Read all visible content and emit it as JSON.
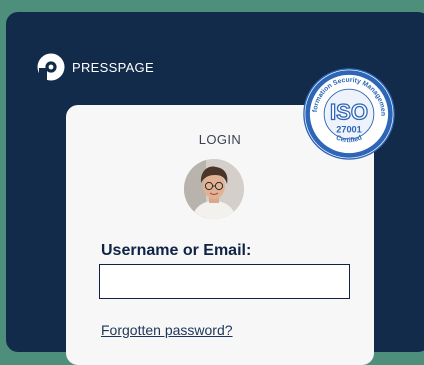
{
  "brand": {
    "name": "PRESSPAGE",
    "logo_icon": "presspage-logo-icon"
  },
  "login": {
    "title": "LOGIN",
    "avatar_icon": "user-avatar-photo",
    "username_label": "Username or Email:",
    "username_value": "",
    "username_placeholder": "",
    "forgot_link": "Forgotten password?"
  },
  "badge": {
    "top_text": "Information Security Management",
    "mark": "ISO",
    "number": "27001",
    "bottom_text": "Certified"
  },
  "colors": {
    "outer_background": "#4e8f7c",
    "panel": "#132b4a",
    "card": "#f7f7f8",
    "badge_blue": "#2d66b7",
    "text_dark": "#0f2445"
  }
}
